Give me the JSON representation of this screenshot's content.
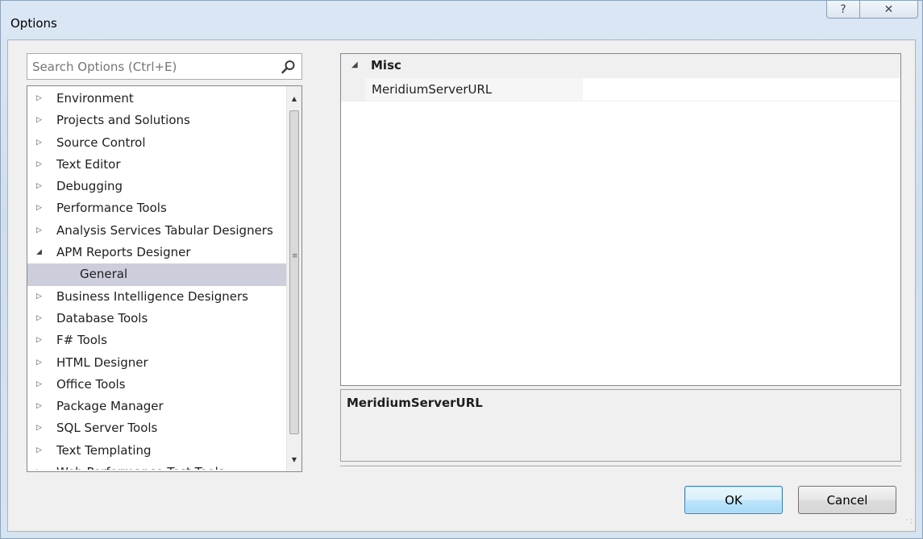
{
  "window": {
    "title": "Options",
    "help_glyph": "?",
    "close_glyph": "✕"
  },
  "search": {
    "placeholder": "Search Options (Ctrl+E)",
    "icon": "search-icon"
  },
  "tree": {
    "items": [
      {
        "label": "Environment",
        "arrow": "▷",
        "level": 0
      },
      {
        "label": "Projects and Solutions",
        "arrow": "▷",
        "level": 0
      },
      {
        "label": "Source Control",
        "arrow": "▷",
        "level": 0
      },
      {
        "label": "Text Editor",
        "arrow": "▷",
        "level": 0
      },
      {
        "label": "Debugging",
        "arrow": "▷",
        "level": 0
      },
      {
        "label": "Performance Tools",
        "arrow": "▷",
        "level": 0
      },
      {
        "label": "Analysis Services Tabular Designers",
        "arrow": "▷",
        "level": 0
      },
      {
        "label": "APM Reports Designer",
        "arrow": "◢",
        "level": 0
      },
      {
        "label": "General",
        "arrow": "",
        "level": 1,
        "selected": true
      },
      {
        "label": "Business Intelligence Designers",
        "arrow": "▷",
        "level": 0
      },
      {
        "label": "Database Tools",
        "arrow": "▷",
        "level": 0
      },
      {
        "label": "F# Tools",
        "arrow": "▷",
        "level": 0
      },
      {
        "label": "HTML Designer",
        "arrow": "▷",
        "level": 0
      },
      {
        "label": "Office Tools",
        "arrow": "▷",
        "level": 0
      },
      {
        "label": "Package Manager",
        "arrow": "▷",
        "level": 0
      },
      {
        "label": "SQL Server Tools",
        "arrow": "▷",
        "level": 0
      },
      {
        "label": "Text Templating",
        "arrow": "▷",
        "level": 0
      },
      {
        "label": "Web Performance Test Tools",
        "arrow": "▷",
        "level": 0
      }
    ],
    "scroll_up_glyph": "▲",
    "scroll_down_glyph": "▼",
    "scroll_grip_glyph": "≡"
  },
  "property_grid": {
    "category": {
      "label": "Misc",
      "arrow": "◢"
    },
    "properties": [
      {
        "name": "MeridiumServerURL",
        "value": ""
      }
    ],
    "description": {
      "title": "MeridiumServerURL"
    }
  },
  "buttons": {
    "ok": "OK",
    "cancel": "Cancel"
  },
  "colors": {
    "selection": "#cccedb",
    "ok_border": "#3c7fb1"
  }
}
